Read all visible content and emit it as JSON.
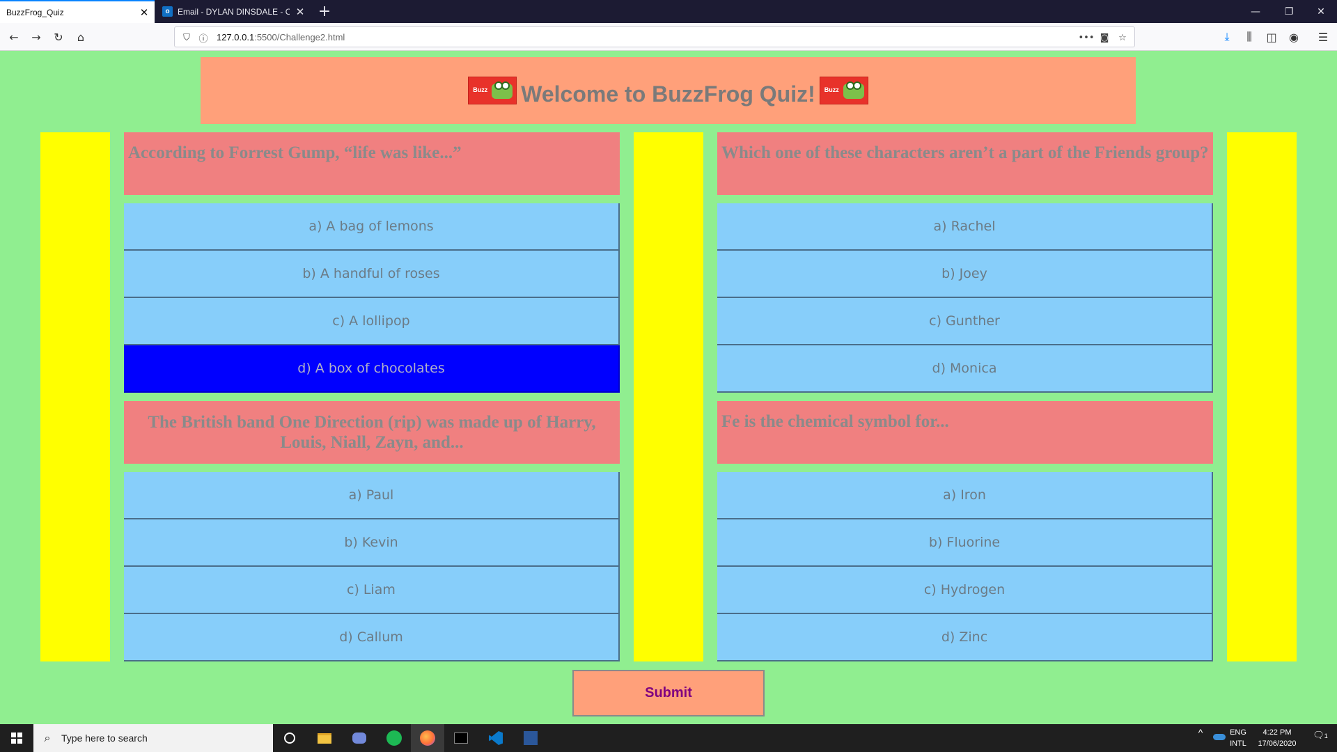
{
  "browser": {
    "tabs": [
      {
        "title": "BuzzFrog_Quiz",
        "active": true
      },
      {
        "title": "Email - DYLAN DINSDALE - Ou",
        "active": false
      }
    ],
    "new_tab_symbol": "+",
    "url": {
      "host": "127.0.0.1",
      "path": ":5500/Challenge2.html"
    },
    "page_actions": "•••"
  },
  "header": {
    "title": "Welcome to BuzzFrog Quiz!",
    "logo_text": "Buzz"
  },
  "questions": [
    {
      "question": "According to Forrest Gump, “life was like...”",
      "answers": [
        "a) A bag of lemons",
        "b) A handful of roses",
        "c) A lollipop",
        "d) A box of chocolates"
      ],
      "selected_index": 3
    },
    {
      "question": "Which one of these characters aren’t a part of the Friends group?",
      "answers": [
        "a) Rachel",
        "b) Joey",
        "c) Gunther",
        "d) Monica"
      ],
      "selected_index": null
    },
    {
      "question": "The British band One Direction (rip) was made up of Harry, Louis, Niall, Zayn, and...",
      "answers": [
        "a) Paul",
        "b) Kevin",
        "c) Liam",
        "d) Callum"
      ],
      "selected_index": null
    },
    {
      "question": "Fe is the chemical symbol for...",
      "answers": [
        "a) Iron",
        "b) Fluorine",
        "c) Hydrogen",
        "d) Zinc"
      ],
      "selected_index": null
    }
  ],
  "submit_label": "Submit",
  "taskbar": {
    "search_placeholder": "Type here to search",
    "language_line1": "ENG",
    "language_line2": "INTL",
    "time": "4:22 PM",
    "date": "17/06/2020",
    "notification_count": "1"
  },
  "colors": {
    "page_bg": "#90ee90",
    "header_bg": "#ffa07a",
    "side_bar": "#ffff00",
    "question_bg": "#f08080",
    "answer_bg": "#87cefa",
    "answer_selected_bg": "#0000ff",
    "submit_text": "#800080"
  }
}
